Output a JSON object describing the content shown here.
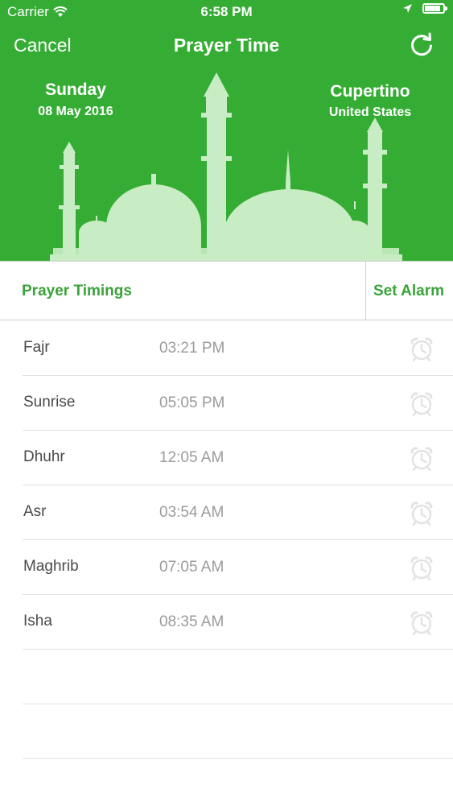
{
  "status_bar": {
    "carrier": "Carrier",
    "time": "6:58 PM",
    "battery_fraction": 0.88
  },
  "nav": {
    "cancel": "Cancel",
    "title": "Prayer Time",
    "refresh_icon": "refresh-icon"
  },
  "header": {
    "day": "Sunday",
    "date": "08 May 2016",
    "city": "Cupertino",
    "country": "United States"
  },
  "section": {
    "label": "Prayer Timings",
    "alarm": "Set Alarm"
  },
  "prayers": [
    {
      "name": "Fajr",
      "time": "03:21 PM"
    },
    {
      "name": "Sunrise",
      "time": "05:05 PM"
    },
    {
      "name": "Dhuhr",
      "time": "12:05 AM"
    },
    {
      "name": "Asr",
      "time": "03:54 AM"
    },
    {
      "name": "Maghrib",
      "time": "07:05 AM"
    },
    {
      "name": "Isha",
      "time": "08:35 AM"
    }
  ],
  "colors": {
    "primary_green": "#35ad34",
    "accent_text": "#3aa33a",
    "mosque_tint": "#c8ecc3"
  }
}
